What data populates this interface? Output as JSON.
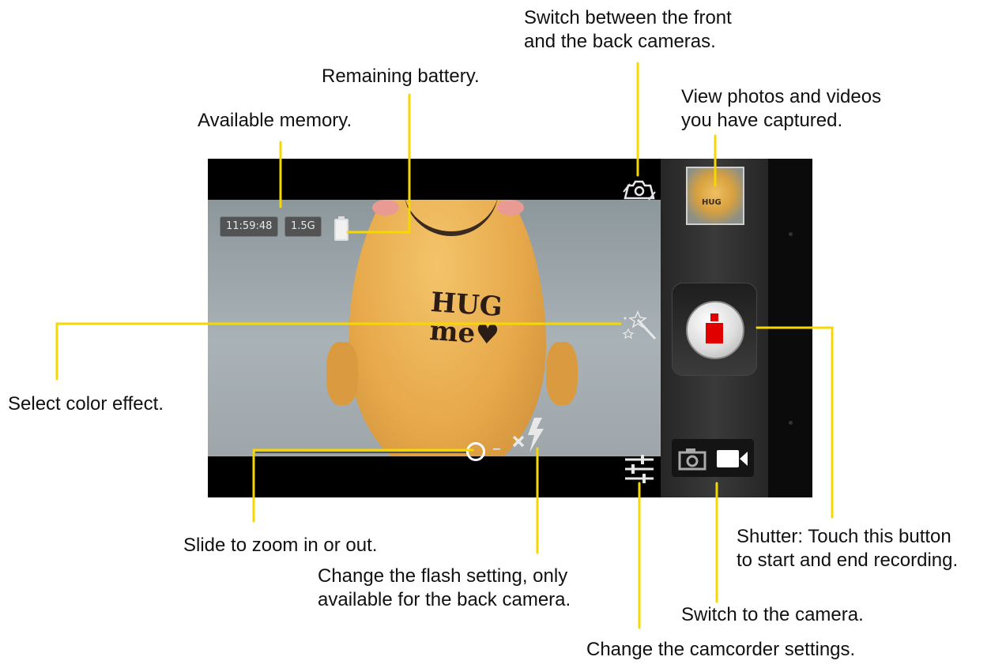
{
  "camera_ui": {
    "time_remaining": "11:59:48",
    "memory": "1.5G",
    "egg_text_line1": "HUG",
    "egg_text_line2": "me♥"
  },
  "icons": {
    "switch_camera": "camera-switch-icon",
    "color_effect": "magic-wand-icon",
    "flash": "flash-icon",
    "settings": "sliders-icon",
    "camera_mode": "camera-icon",
    "video_mode": "video-camera-icon",
    "battery": "battery-icon",
    "record": "record-icon"
  },
  "colors": {
    "callout_line": "#f5d800",
    "record_red": "#e00000"
  },
  "callouts": {
    "switch_cameras": [
      "Switch between the front",
      "and the back cameras."
    ],
    "remaining_battery": "Remaining battery.",
    "view_photos": [
      "View photos and videos",
      "you have captured."
    ],
    "available_memory": "Available memory.",
    "select_color_effect": "Select color effect.",
    "slide_zoom": "Slide to zoom in or out.",
    "flash_setting": [
      "Change the flash setting, only",
      "available for the back camera."
    ],
    "shutter": [
      "Shutter: Touch this button",
      "to start and end recording."
    ],
    "switch_to_camera": "Switch to the camera.",
    "camcorder_settings": "Change the camcorder settings."
  }
}
